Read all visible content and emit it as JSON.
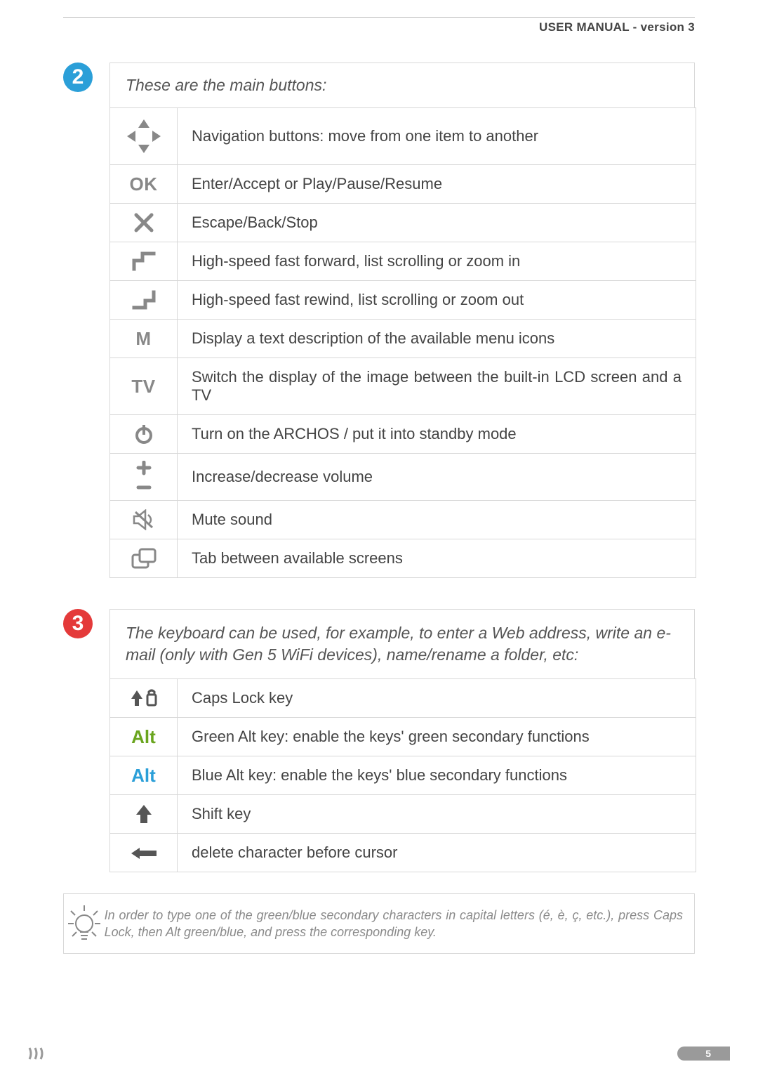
{
  "header": {
    "title": "USER MANUAL - version 3"
  },
  "section2": {
    "number": "2",
    "intro": "These are the main buttons:",
    "rows": [
      {
        "icon": "dpad",
        "desc": "Navigation buttons: move from one item to another"
      },
      {
        "icon": "ok",
        "label": "OK",
        "desc": "Enter/Accept or Play/Pause/Resume"
      },
      {
        "icon": "x",
        "desc": "Escape/Back/Stop"
      },
      {
        "icon": "ff",
        "desc": "High-speed fast forward, list scrolling or zoom in"
      },
      {
        "icon": "fr",
        "desc": "High-speed fast rewind, list scrolling or zoom out"
      },
      {
        "icon": "m",
        "label": "M",
        "desc": "Display a text description of the available menu icons"
      },
      {
        "icon": "tv",
        "label": "TV",
        "desc": "Switch the display of the image between the built-in LCD screen and a TV"
      },
      {
        "icon": "power",
        "desc": "Turn on the ARCHOS / put it into standby mode"
      },
      {
        "icon": "vol",
        "desc": "Increase/decrease volume"
      },
      {
        "icon": "mute",
        "desc": "Mute sound"
      },
      {
        "icon": "tab",
        "desc": "Tab between available screens"
      }
    ]
  },
  "section3": {
    "number": "3",
    "intro": "The keyboard can be used, for example, to enter a Web address, write an e-mail (only with Gen 5 WiFi devices), name/rename a folder, etc:",
    "rows": [
      {
        "icon": "caps",
        "desc": "Caps Lock key"
      },
      {
        "icon": "altgreen",
        "label": "Alt",
        "desc": "Green Alt key: enable the keys' green secondary functions"
      },
      {
        "icon": "altblue",
        "label": "Alt",
        "desc": "Blue Alt key: enable the keys' blue secondary functions"
      },
      {
        "icon": "shift",
        "desc": "Shift key"
      },
      {
        "icon": "del",
        "desc": "delete character before cursor"
      }
    ]
  },
  "tip": {
    "text": "In order to type one of the green/blue secondary characters in capital letters (é, è, ç, etc.), press Caps Lock, then Alt green/blue, and press the corresponding key."
  },
  "page_number": "5"
}
